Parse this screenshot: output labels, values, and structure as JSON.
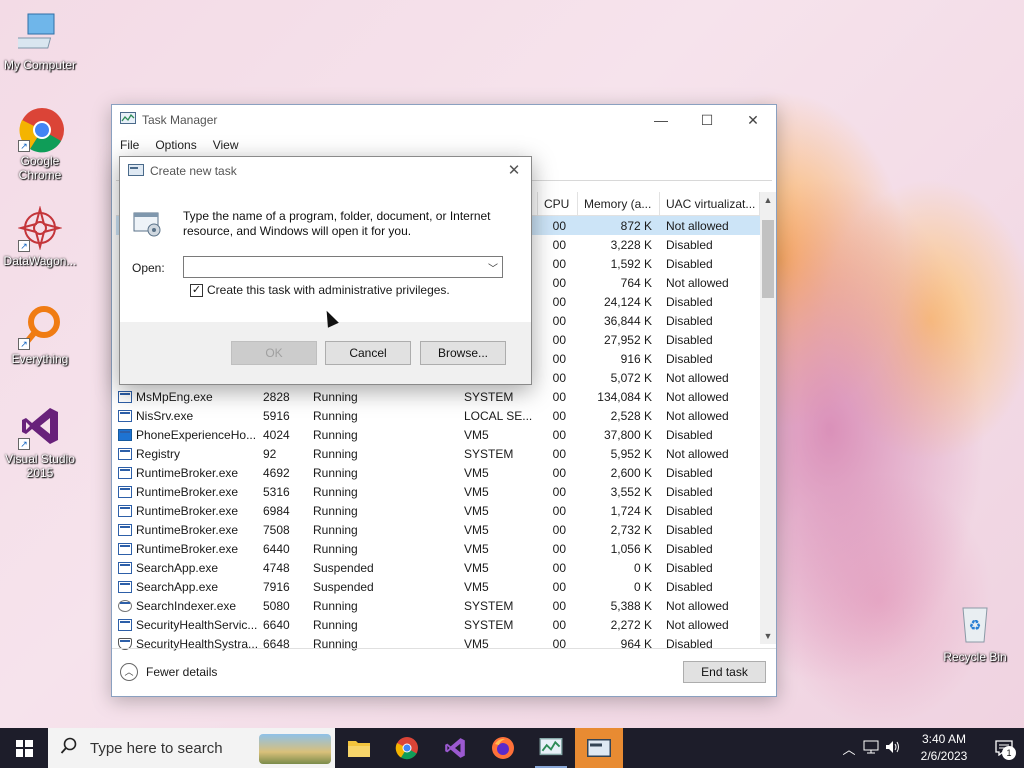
{
  "desktop": {
    "icons": [
      {
        "label": "My Computer"
      },
      {
        "label": "Google Chrome"
      },
      {
        "label": "DataWagon..."
      },
      {
        "label": "Everything"
      },
      {
        "label": "Visual Studio 2015"
      },
      {
        "label": "Recycle Bin"
      }
    ]
  },
  "task_manager": {
    "title": "Task Manager",
    "menu": [
      "File",
      "Options",
      "View"
    ],
    "columns": [
      "CPU",
      "Memory (a...",
      "UAC virtualizat..."
    ],
    "rows": [
      {
        "name": "",
        "pid": "",
        "status": "",
        "user": "",
        "cpu": "00",
        "mem": "872 K",
        "uac": "Not allowed",
        "selected": true
      },
      {
        "name": "",
        "pid": "",
        "status": "",
        "user": "",
        "cpu": "00",
        "mem": "3,228 K",
        "uac": "Disabled"
      },
      {
        "name": "",
        "pid": "",
        "status": "",
        "user": "",
        "cpu": "00",
        "mem": "1,592 K",
        "uac": "Disabled"
      },
      {
        "name": "",
        "pid": "",
        "status": "",
        "user": "",
        "cpu": "00",
        "mem": "764 K",
        "uac": "Not allowed"
      },
      {
        "name": "",
        "pid": "",
        "status": "",
        "user": "",
        "cpu": "00",
        "mem": "24,124 K",
        "uac": "Disabled"
      },
      {
        "name": "",
        "pid": "",
        "status": "",
        "user": "",
        "cpu": "00",
        "mem": "36,844 K",
        "uac": "Disabled"
      },
      {
        "name": "",
        "pid": "",
        "status": "",
        "user": "",
        "cpu": "00",
        "mem": "27,952 K",
        "uac": "Disabled"
      },
      {
        "name": "",
        "pid": "",
        "status": "",
        "user": "",
        "cpu": "00",
        "mem": "916 K",
        "uac": "Disabled"
      },
      {
        "name": "",
        "pid": "",
        "status": "",
        "user": "",
        "cpu": "00",
        "mem": "5,072 K",
        "uac": "Not allowed"
      },
      {
        "name": "MsMpEng.exe",
        "pid": "2828",
        "status": "Running",
        "user": "SYSTEM",
        "cpu": "00",
        "mem": "134,084 K",
        "uac": "Not allowed"
      },
      {
        "name": "NisSrv.exe",
        "pid": "5916",
        "status": "Running",
        "user": "LOCAL SE...",
        "cpu": "00",
        "mem": "2,528 K",
        "uac": "Not allowed"
      },
      {
        "name": "PhoneExperienceHo...",
        "pid": "4024",
        "status": "Running",
        "user": "VM5",
        "cpu": "00",
        "mem": "37,800 K",
        "uac": "Disabled",
        "icon": "blue"
      },
      {
        "name": "Registry",
        "pid": "92",
        "status": "Running",
        "user": "SYSTEM",
        "cpu": "00",
        "mem": "5,952 K",
        "uac": "Not allowed"
      },
      {
        "name": "RuntimeBroker.exe",
        "pid": "4692",
        "status": "Running",
        "user": "VM5",
        "cpu": "00",
        "mem": "2,600 K",
        "uac": "Disabled"
      },
      {
        "name": "RuntimeBroker.exe",
        "pid": "5316",
        "status": "Running",
        "user": "VM5",
        "cpu": "00",
        "mem": "3,552 K",
        "uac": "Disabled"
      },
      {
        "name": "RuntimeBroker.exe",
        "pid": "6984",
        "status": "Running",
        "user": "VM5",
        "cpu": "00",
        "mem": "1,724 K",
        "uac": "Disabled"
      },
      {
        "name": "RuntimeBroker.exe",
        "pid": "7508",
        "status": "Running",
        "user": "VM5",
        "cpu": "00",
        "mem": "2,732 K",
        "uac": "Disabled"
      },
      {
        "name": "RuntimeBroker.exe",
        "pid": "6440",
        "status": "Running",
        "user": "VM5",
        "cpu": "00",
        "mem": "1,056 K",
        "uac": "Disabled"
      },
      {
        "name": "SearchApp.exe",
        "pid": "4748",
        "status": "Suspended",
        "user": "VM5",
        "cpu": "00",
        "mem": "0 K",
        "uac": "Disabled"
      },
      {
        "name": "SearchApp.exe",
        "pid": "7916",
        "status": "Suspended",
        "user": "VM5",
        "cpu": "00",
        "mem": "0 K",
        "uac": "Disabled"
      },
      {
        "name": "SearchIndexer.exe",
        "pid": "5080",
        "status": "Running",
        "user": "SYSTEM",
        "cpu": "00",
        "mem": "5,388 K",
        "uac": "Not allowed",
        "icon": "gear"
      },
      {
        "name": "SecurityHealthServic...",
        "pid": "6640",
        "status": "Running",
        "user": "SYSTEM",
        "cpu": "00",
        "mem": "2,272 K",
        "uac": "Not allowed"
      },
      {
        "name": "SecurityHealthSystra...",
        "pid": "6648",
        "status": "Running",
        "user": "VM5",
        "cpu": "00",
        "mem": "964 K",
        "uac": "Disabled",
        "icon": "shield"
      }
    ],
    "fewer_details": "Fewer details",
    "end_task": "End task"
  },
  "dialog": {
    "title": "Create new task",
    "description": "Type the name of a program, folder, document, or Internet resource, and Windows will open it for you.",
    "open_label": "Open:",
    "open_value": "",
    "admin_checkbox_label": "Create this task with administrative privileges.",
    "admin_checked": true,
    "ok": "OK",
    "cancel": "Cancel",
    "browse": "Browse..."
  },
  "taskbar": {
    "search_placeholder": "Type here to search",
    "time": "3:40 AM",
    "date": "2/6/2023",
    "notification_count": "1",
    "accent": "#e88b32"
  }
}
